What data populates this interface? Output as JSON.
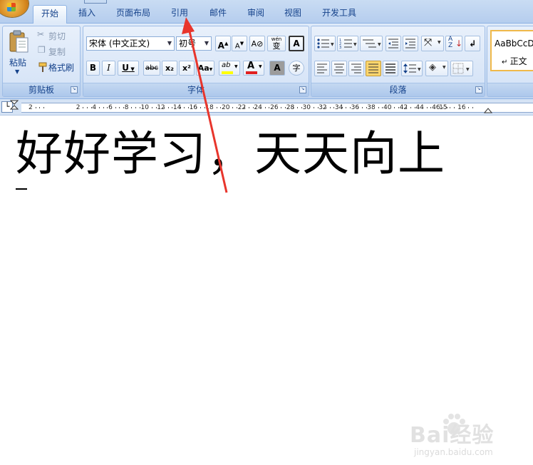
{
  "tabs": [
    "开始",
    "插入",
    "页面布局",
    "引用",
    "邮件",
    "审阅",
    "视图",
    "开发工具"
  ],
  "clipboard": {
    "group_label": "剪贴板",
    "paste": "粘贴",
    "cut": "剪切",
    "copy": "复制",
    "format_painter": "格式刷"
  },
  "font": {
    "group_label": "字体",
    "font_name": "宋体 (中文正文)",
    "font_size": "初号",
    "grow": "A",
    "shrink": "A",
    "phonetic": "wén",
    "phonetic_char": "变",
    "border_char": "A",
    "bold": "B",
    "italic": "I",
    "underline": "U",
    "strike": "abc",
    "subscript": "x₂",
    "superscript": "x²",
    "change_case": "Aa",
    "highlight": "ab",
    "font_color": "A",
    "char_shading": "A",
    "enclose": "字"
  },
  "paragraph": {
    "group_label": "段落"
  },
  "styles": {
    "sample": "AaBbCcDc",
    "name": "正文"
  },
  "ruler": {
    "labels": [
      "2",
      "2",
      "4",
      "6",
      "8",
      "10",
      "12",
      "14",
      "16",
      "18",
      "20",
      "22",
      "24",
      "26",
      "28",
      "30",
      "32",
      "34",
      "36",
      "38",
      "40",
      "42",
      "44",
      "46",
      "15",
      "16"
    ]
  },
  "document": {
    "text": "好好学习，天天向上"
  },
  "watermark": {
    "brand": "Bai经验",
    "url": "jingyan.baidu.com"
  },
  "colors": {
    "highlight": "#ffff00",
    "font_color": "#e02020",
    "arrow": "#e8352c",
    "active_para": "#fbd56d"
  },
  "icons": [
    "office-button-icon",
    "paste-icon",
    "cut-icon",
    "copy-icon",
    "format-painter-icon",
    "bullets-icon",
    "numbering-icon",
    "multilevel-icon",
    "decrease-indent-icon",
    "increase-indent-icon",
    "chinese-layout-icon",
    "sort-icon",
    "show-marks-icon",
    "align-left-icon",
    "center-icon",
    "align-right-icon",
    "justify-icon",
    "distributed-icon",
    "line-spacing-icon",
    "shading-icon",
    "borders-icon",
    "dialog-launcher-icon",
    "red-arrow-icon"
  ]
}
